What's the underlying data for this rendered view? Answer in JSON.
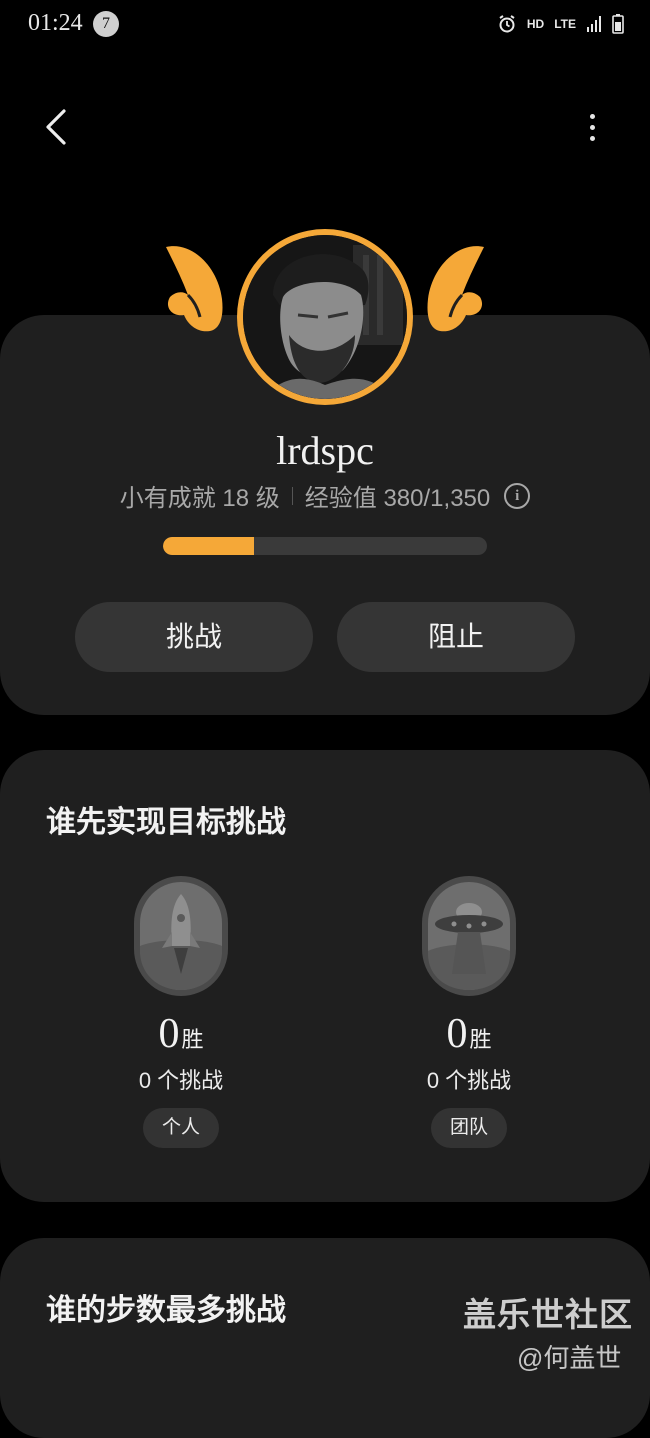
{
  "status_bar": {
    "time": "01:24",
    "notification_count": "7",
    "hd": "HD",
    "lte": "LTE"
  },
  "icons": {
    "back": "chevron-left-icon",
    "more": "more-vertical-icon",
    "info": "info-icon",
    "alarm": "alarm-icon",
    "signal": "signal-icon",
    "battery": "battery-icon"
  },
  "colors": {
    "accent": "#f5a838",
    "card": "#1f1f1f",
    "button": "#353535",
    "background": "#000000"
  },
  "profile": {
    "username": "lrdspc",
    "level_text": "小有成就 18 级",
    "exp_text": "经验值 380/1,350",
    "info_glyph": "i",
    "progress_fraction": 0.28,
    "challenge_button": "挑战",
    "block_button": "阻止"
  },
  "first_to_goal": {
    "title": "谁先实现目标挑战",
    "personal": {
      "wins": "0",
      "wins_unit": "胜",
      "challenges": "0 个挑战",
      "label": "个人"
    },
    "team": {
      "wins": "0",
      "wins_unit": "胜",
      "challenges": "0 个挑战",
      "label": "团队"
    }
  },
  "most_steps": {
    "title": "谁的步数最多挑战"
  },
  "watermark": {
    "line1": "盖乐世社区",
    "line2": "@何盖世"
  }
}
